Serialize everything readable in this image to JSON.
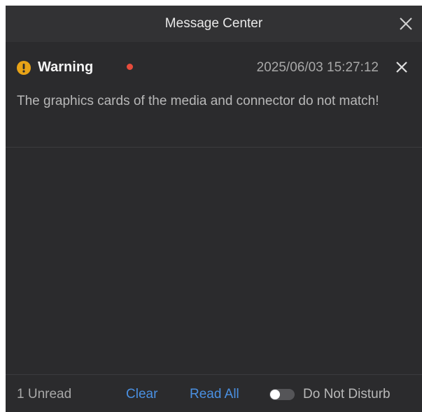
{
  "header": {
    "title": "Message Center",
    "close_icon": "close-icon"
  },
  "messages": [
    {
      "level_icon": "warning-icon",
      "level_color": "#e8a317",
      "title": "Warning",
      "unread": true,
      "unread_dot_color": "#e74c3c",
      "timestamp": "2025/06/03 15:27:12",
      "body": "The graphics cards of the media and connector do not match!",
      "close_icon": "close-icon"
    }
  ],
  "footer": {
    "unread_count": "1 Unread",
    "clear_label": "Clear",
    "read_all_label": "Read All",
    "do_not_disturb_label": "Do Not Disturb",
    "do_not_disturb_enabled": false,
    "link_color": "#4a90e2"
  }
}
